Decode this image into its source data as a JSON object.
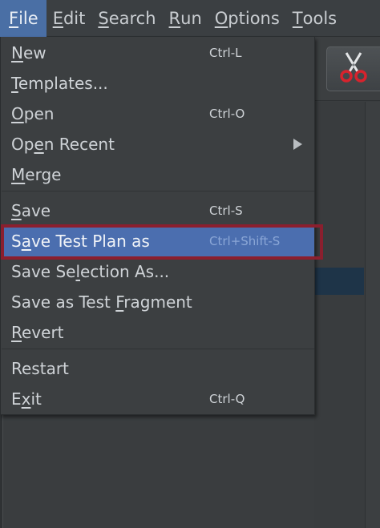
{
  "menubar": {
    "items": [
      {
        "pre": "",
        "mn": "F",
        "post": "ile"
      },
      {
        "pre": "",
        "mn": "E",
        "post": "dit"
      },
      {
        "pre": "",
        "mn": "S",
        "post": "earch"
      },
      {
        "pre": "",
        "mn": "R",
        "post": "un"
      },
      {
        "pre": "",
        "mn": "O",
        "post": "ptions"
      },
      {
        "pre": "",
        "mn": "T",
        "post": "ools"
      }
    ]
  },
  "file_menu": {
    "items": [
      {
        "pre": "",
        "mn": "N",
        "post": "ew",
        "shortcut": "Ctrl-L"
      },
      {
        "pre": "",
        "mn": "T",
        "post": "emplates...",
        "shortcut": ""
      },
      {
        "pre": "",
        "mn": "O",
        "post": "pen",
        "shortcut": "Ctrl-O"
      },
      {
        "pre": "Op",
        "mn": "e",
        "post": "n Recent",
        "shortcut": ""
      },
      {
        "pre": "",
        "mn": "M",
        "post": "erge",
        "shortcut": ""
      },
      {
        "pre": "",
        "mn": "S",
        "post": "ave",
        "shortcut": "Ctrl-S"
      },
      {
        "pre": "S",
        "mn": "a",
        "post": "ve Test Plan as",
        "shortcut": "Ctrl+Shift-S"
      },
      {
        "pre": "Save Se",
        "mn": "l",
        "post": "ection As...",
        "shortcut": ""
      },
      {
        "pre": "Save as Test ",
        "mn": "F",
        "post": "ragment",
        "shortcut": ""
      },
      {
        "pre": "",
        "mn": "R",
        "post": "evert",
        "shortcut": ""
      },
      {
        "pre": "Restart",
        "mn": "",
        "post": "",
        "shortcut": ""
      },
      {
        "pre": "E",
        "mn": "x",
        "post": "it",
        "shortcut": "Ctrl-Q"
      }
    ]
  },
  "colors": {
    "menu_bg": "#3c3f41",
    "highlight": "#4b6eaf",
    "focus_outline": "#8b1f2e",
    "text": "#cfd3d7"
  },
  "icons": {
    "cut": "scissors-icon",
    "submenu": "arrow-right-icon"
  }
}
